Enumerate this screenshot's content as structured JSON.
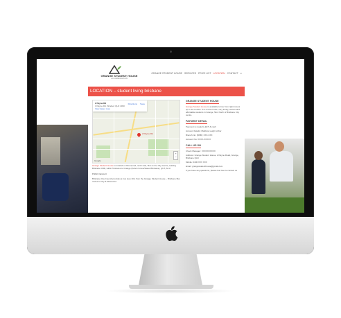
{
  "site": {
    "logo": {
      "title": "GRANGE STUDENT HOUSE",
      "subtitle": "ACCOMMODATION"
    },
    "nav": [
      {
        "label": "GRANGE STUDENT HOUSE",
        "active": false
      },
      {
        "label": "SERVICES",
        "active": false
      },
      {
        "label": "PRICE LIST",
        "active": false
      },
      {
        "label": "LOCATION",
        "active": true
      },
      {
        "label": "CONTACT",
        "active": false
      }
    ],
    "search_icon": "search-icon",
    "banner_title": "LOCATION – student living brisbane"
  },
  "map": {
    "address": "2 Payne Rd",
    "suburb": "3 Payne Rd, Windsor QLD 4030",
    "view_larger": "View larger map",
    "directions": "Directions",
    "save": "Save",
    "pin_label": "2 Payne Rd",
    "brand": "Google",
    "zoom_in": "+",
    "zoom_out": "−"
  },
  "main": {
    "intro_highlight": "Grange Student House",
    "intro_text": "is located on bitumened, north side, 5km to the City Centre, leading Brisbane CBD, within 5minutes to Grange (Kelvin Grove/Sweet Brisbane), QUT, ACU",
    "public_transport_label": "Public transport",
    "transport_text": "Brisbane City Council provides a bus stop 10m from the Grange Student House – Brisbane Bus routes to City & Sherwood"
  },
  "sidebar": {
    "about": {
      "heading": "GRANGE STUDENT HOUSE",
      "highlight": "Grange Student House",
      "text": "is available to live from right now at up to 12 months. If is a nice house, very lovely, secure and affordable students in Grange, 5km North of Brisbane City centre."
    },
    "payment": {
      "heading": "PAYMENT DETAIL",
      "line1": "Payment is made by EFT & cash",
      "line2": "Account Details: Matthew Leigh Archer",
      "line3": "Branch No: (BSB): XXX-XXX",
      "line4": "Account No: XXXX-XXXXX"
    },
    "call": {
      "heading": "CALL US ON",
      "line1": "Check Manager: XXXXXXXXXX",
      "line2": "Address: Grange Student House, 2 Payne Road, Grange, Brisbane QLD",
      "line3": "Mobile: 0400 XXX XXX",
      "line4": "Email: grangestudenthouse@gmail.com",
      "line5": "If you have any questions, please feel free to contact us"
    }
  }
}
